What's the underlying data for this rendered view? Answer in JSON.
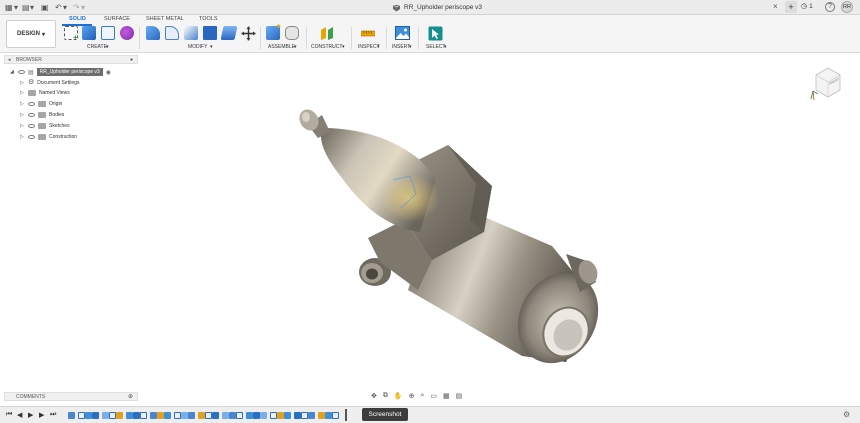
{
  "titlebar": {
    "doc_title": "RR_Upholder periscope v3",
    "job_count": "1",
    "user_initials": "RR",
    "add_tab": "+",
    "close_glyph": "×"
  },
  "toolbar": {
    "workspace": "DESIGN",
    "tabs": [
      "SOLID",
      "SURFACE",
      "SHEET METAL",
      "TOOLS"
    ],
    "groups": [
      "CREATE",
      "MODIFY",
      "ASSEMBLE",
      "CONSTRUCT",
      "INSPECT",
      "INSERT",
      "SELECT"
    ]
  },
  "browser": {
    "title": "BROWSER",
    "root": "RR_Upholder periscope v3",
    "items": [
      "Document Settings",
      "Named Views",
      "Origin",
      "Bodies",
      "Sketches",
      "Construction"
    ]
  },
  "comments": {
    "title": "COMMENTS"
  },
  "viewcube": {
    "face_label": "FRONT"
  },
  "timeline": {
    "tooltip": "Screenshot"
  },
  "colors": {
    "accent": "#1f6fd1",
    "model_metal": "#8a8478"
  }
}
